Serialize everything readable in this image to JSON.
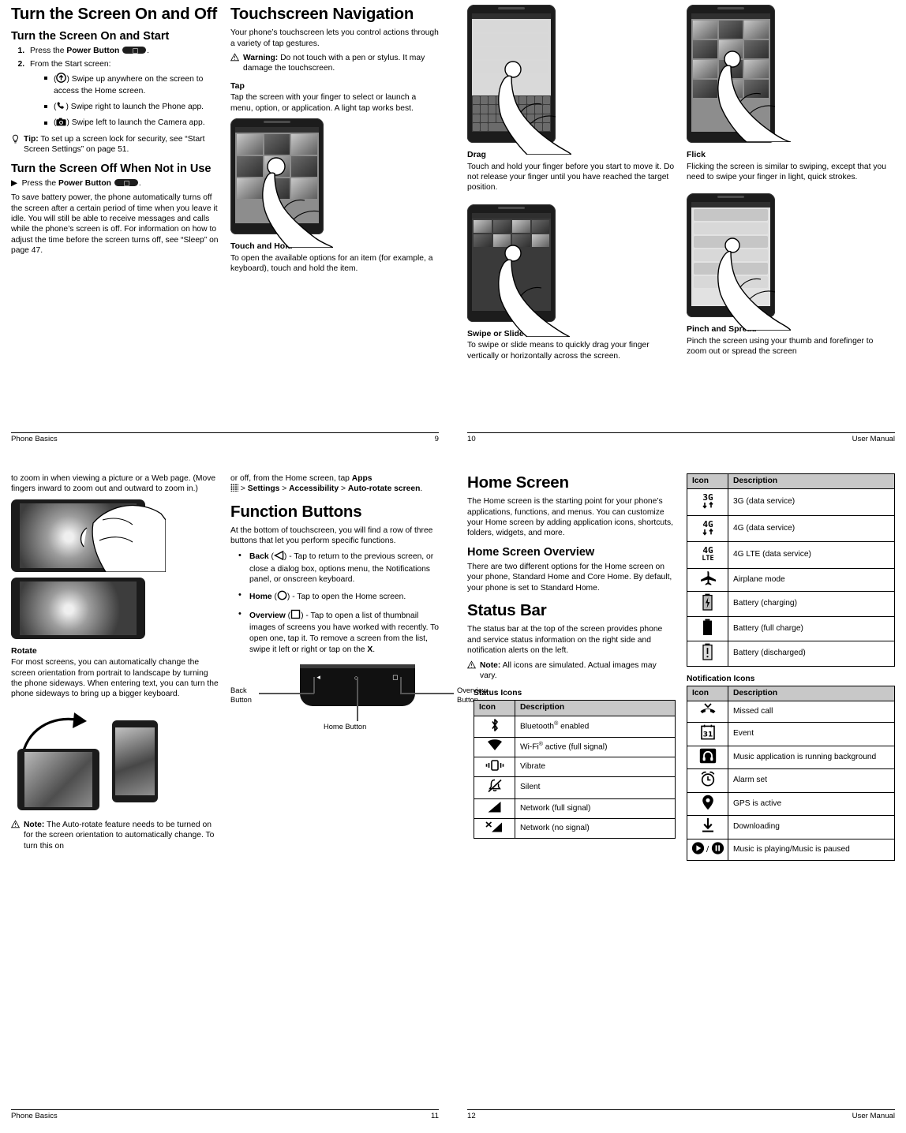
{
  "pages": {
    "p9": {
      "footer_left": "Phone Basics",
      "footer_right": "9",
      "col1": {
        "h1": "Turn the Screen On and Off",
        "h2_a": "Turn the Screen On and Start",
        "step1_pre": "Press the ",
        "step1_bold": "Power Button",
        "step2": "From the Start screen:",
        "sub_a_pre": "(",
        "sub_a_post": ") Swipe up anywhere on the screen to access the Home screen.",
        "sub_b_post": ") Swipe right to launch the Phone app.",
        "sub_c_post": ") Swipe left to launch the Camera app.",
        "tip_label": "Tip:",
        "tip_text": " To set up a screen lock for security, see “Start Screen Settings” on page 51.",
        "h2_b": "Turn the Screen Off When Not in Use",
        "arrow_step_pre": "Press the ",
        "arrow_step_bold": "Power Button",
        "para_save": "To save battery power, the phone automatically turns off the screen after a certain period of time when you leave it idle. You will still be able to receive messages and calls while the phone’s screen is off. For information on how to adjust the time before the screen turns off, see “Sleep” on page 47."
      },
      "col2": {
        "h1": "Touchscreen Navigation",
        "intro": "Your phone’s touchscreen lets you control actions through a variety of tap gestures.",
        "warning_label": "Warning:",
        "warning_text": " Do not touch with a pen or stylus. It may damage the touchscreen.",
        "tap_h": "Tap",
        "tap_p": "Tap the screen with your finger to select or launch a menu, option, or application. A light tap works best.",
        "touchhold_h": "Touch and Hold",
        "touchhold_p": "To open the available options for an item (for example, a keyboard), touch and hold the item."
      }
    },
    "p10": {
      "footer_left": "10",
      "footer_right": "User Manual",
      "col1": {
        "drag_h": "Drag",
        "drag_p": "Touch and hold your finger before you start to move it. Do not release your finger until you have reached the target position.",
        "swipe_h": "Swipe or Slide",
        "swipe_p": "To swipe or slide means to quickly drag your finger vertically or horizontally across the screen."
      },
      "col2": {
        "flick_h": "Flick",
        "flick_p": "Flicking the screen is similar to swiping, except that you need to swipe your finger in light, quick strokes.",
        "pinch_h": "Pinch and Spread",
        "pinch_p": "Pinch the screen using your thumb and forefinger to zoom out or spread the screen"
      }
    },
    "p11": {
      "footer_left": "Phone Basics",
      "footer_right": "11",
      "col1": {
        "cont_p": "to zoom in when viewing a picture or a Web page. (Move fingers inward to zoom out and outward to zoom in.)",
        "rotate_h": "Rotate",
        "rotate_p": "For most screens, you can automatically change the screen orientation from portrait to landscape by turning the phone sideways. When entering text, you can turn the phone sideways to bring up a bigger keyboard.",
        "note_label": "Note:",
        "note_text": " The Auto-rotate feature needs to be turned on for the screen orientation to automatically change. To turn this on"
      },
      "col2": {
        "cont_a": "or off, from the Home screen, tap ",
        "cont_apps": "Apps",
        "cont_b": " > ",
        "cont_settings": "Settings",
        "cont_c": " > ",
        "cont_access": "Accessibility",
        "cont_d": " > ",
        "cont_autorotate": "Auto-rotate screen",
        "cont_end": ".",
        "h1": "Function Buttons",
        "intro": "At the bottom of touchscreen, you will find a row of three buttons that let you perform specific functions.",
        "back_label": "Back",
        "back_text": ") - Tap to return to the previous screen, or close a dialog box, options menu, the Notifications panel, or onscreen keyboard.",
        "home_label": "Home",
        "home_text": ") - Tap to open the Home screen.",
        "overview_label": "Overview",
        "overview_text": ") - Tap to open a list of thumbnail images of screens you have worked with recently. To open one, tap it. To remove a screen from the list, swipe it left or right or tap on the ",
        "overview_x": "X",
        "overview_end": ".",
        "fig_back": "Back\nButton",
        "fig_home": "Home Button",
        "fig_overview": "Overview\nButton"
      }
    },
    "p12": {
      "footer_left": "12",
      "footer_right": "User Manual",
      "col1": {
        "h1": "Home Screen",
        "home_p": "The Home screen is the starting point for your phone’s applications, functions, and menus. You can customize your Home screen by adding application icons, shortcuts, folders, widgets, and more.",
        "h2_overview": "Home Screen Overview",
        "overview_p": "There are two different options for the Home screen on your phone, Standard Home and Core Home. By default, your phone is set to Standard Home.",
        "h1_statusbar": "Status Bar",
        "statusbar_p": "The status bar at the top of the screen provides phone and service status information on the right side and notification alerts on the left.",
        "note_label": "Note:",
        "note_text": " All icons are simulated. Actual images may vary.",
        "status_icons_label": "Status Icons",
        "status_table": {
          "headers": [
            "Icon",
            "Description"
          ],
          "rows": [
            {
              "icon": "bluetooth-icon",
              "desc": "Bluetooth",
              "sup": "®",
              "desc_tail": " enabled"
            },
            {
              "icon": "wifi-icon",
              "desc": "Wi-Fi",
              "sup": "®",
              "desc_tail": " active (full signal)"
            },
            {
              "icon": "vibrate-icon",
              "desc": "Vibrate",
              "sup": "",
              "desc_tail": ""
            },
            {
              "icon": "silent-icon",
              "desc": "Silent",
              "sup": "",
              "desc_tail": ""
            },
            {
              "icon": "signal-full-icon",
              "desc": "Network (full signal)",
              "sup": "",
              "desc_tail": ""
            },
            {
              "icon": "signal-none-icon",
              "desc": "Network (no signal)",
              "sup": "",
              "desc_tail": ""
            }
          ]
        }
      },
      "col2": {
        "service_table": {
          "headers": [
            "Icon",
            "Description"
          ],
          "rows": [
            {
              "icon": "3g-icon",
              "desc": "3G (data service)"
            },
            {
              "icon": "4g-icon",
              "desc": "4G (data service)"
            },
            {
              "icon": "4g-lte-icon",
              "desc": "4G LTE (data service)"
            },
            {
              "icon": "airplane-icon",
              "desc": "Airplane mode"
            },
            {
              "icon": "battery-charging-icon",
              "desc": "Battery (charging)"
            },
            {
              "icon": "battery-full-icon",
              "desc": "Battery (full charge)"
            },
            {
              "icon": "battery-discharged-icon",
              "desc": "Battery (discharged)"
            }
          ]
        },
        "notification_icons_label": "Notification Icons",
        "notification_table": {
          "headers": [
            "Icon",
            "Description"
          ],
          "rows": [
            {
              "icon": "missed-call-icon",
              "desc": "Missed call"
            },
            {
              "icon": "event-icon",
              "desc": "Event"
            },
            {
              "icon": "music-running-icon",
              "desc": "Music application is running background"
            },
            {
              "icon": "alarm-icon",
              "desc": "Alarm set"
            },
            {
              "icon": "gps-icon",
              "desc": "GPS is active"
            },
            {
              "icon": "download-icon",
              "desc": "Downloading"
            },
            {
              "icon": "music-play-pause-icon",
              "desc": "Music is playing/Music is paused"
            }
          ]
        }
      }
    }
  }
}
